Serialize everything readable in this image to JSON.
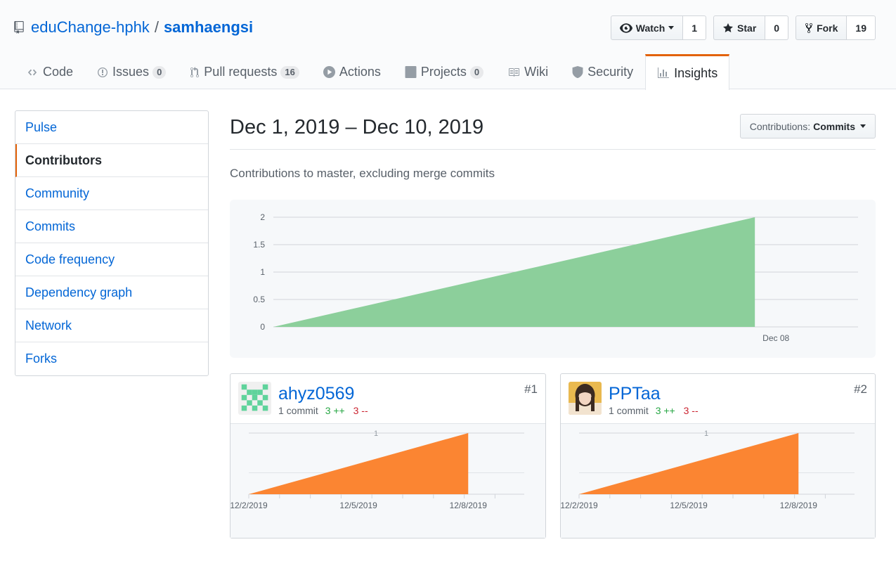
{
  "repo": {
    "owner": "eduChange-hphk",
    "separator": "/",
    "name": "samhaengsi"
  },
  "actions": {
    "watch": {
      "label": "Watch",
      "count": "1"
    },
    "star": {
      "label": "Star",
      "count": "0"
    },
    "fork": {
      "label": "Fork",
      "count": "19"
    }
  },
  "nav": [
    {
      "label": "Code",
      "icon": "code-icon"
    },
    {
      "label": "Issues",
      "counter": "0",
      "icon": "issue-icon"
    },
    {
      "label": "Pull requests",
      "counter": "16",
      "icon": "pull-request-icon"
    },
    {
      "label": "Actions",
      "icon": "play-icon"
    },
    {
      "label": "Projects",
      "counter": "0",
      "icon": "project-icon"
    },
    {
      "label": "Wiki",
      "icon": "book-icon"
    },
    {
      "label": "Security",
      "icon": "shield-icon"
    },
    {
      "label": "Insights",
      "icon": "graph-icon",
      "selected": true
    }
  ],
  "sidebar": [
    {
      "label": "Pulse"
    },
    {
      "label": "Contributors",
      "selected": true
    },
    {
      "label": "Community"
    },
    {
      "label": "Commits"
    },
    {
      "label": "Code frequency"
    },
    {
      "label": "Dependency graph"
    },
    {
      "label": "Network"
    },
    {
      "label": "Forks"
    }
  ],
  "main": {
    "date_range": "Dec 1, 2019 – Dec 10, 2019",
    "contrib_select": {
      "prefix": "Contributions:",
      "value": "Commits"
    },
    "description": "Contributions to master, excluding merge commits"
  },
  "contributors": [
    {
      "name": "ahyz0569",
      "commits": "1 commit",
      "additions": "3 ++",
      "deletions": "3 --",
      "rank": "#1"
    },
    {
      "name": "PPTaa",
      "commits": "1 commit",
      "additions": "3 ++",
      "deletions": "3 --",
      "rank": "#2"
    }
  ],
  "colors": {
    "link": "#0366d6",
    "accent": "#e36209",
    "main_area": "#8ccf9b",
    "contrib_area": "#fb8532"
  },
  "chart_data": [
    {
      "type": "area",
      "x": [
        "Dec 01",
        "Dec 08"
      ],
      "y": [
        0,
        2
      ],
      "x_tick_labels": [
        "Dec 08"
      ],
      "y_ticks": [
        "0",
        "0.5",
        "1",
        "1.5",
        "2"
      ],
      "ylim": [
        0,
        2
      ],
      "grid": true
    },
    {
      "type": "area",
      "x": [
        "12/2/2019",
        "12/8/2019"
      ],
      "y": [
        0,
        1
      ],
      "x_tick_labels": [
        "12/2/2019",
        "12/5/2019",
        "12/8/2019"
      ],
      "y_ticks": [
        "1"
      ],
      "ylim": [
        0,
        1
      ]
    },
    {
      "type": "area",
      "x": [
        "12/2/2019",
        "12/8/2019"
      ],
      "y": [
        0,
        1
      ],
      "x_tick_labels": [
        "12/2/2019",
        "12/5/2019",
        "12/8/2019"
      ],
      "y_ticks": [
        "1"
      ],
      "ylim": [
        0,
        1
      ]
    }
  ]
}
